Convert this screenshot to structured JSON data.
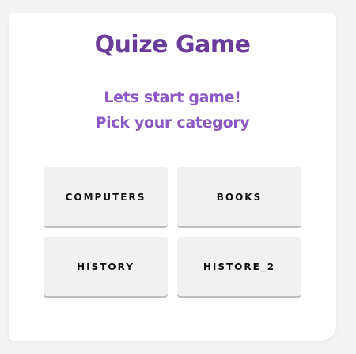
{
  "game": {
    "title": "Quize Game",
    "subtitle_line1": "Lets start game!",
    "subtitle_line2": "Pick your category"
  },
  "categories": [
    {
      "label": "COMPUTERS"
    },
    {
      "label": "BOOKS"
    },
    {
      "label": "HISTORY"
    },
    {
      "label": "HISTORE_2"
    }
  ],
  "colors": {
    "title": "#6a3d99",
    "subtitle": "#8b58c4",
    "button_bg": "#f1f1f1",
    "page_bg": "#f3f3f3"
  }
}
